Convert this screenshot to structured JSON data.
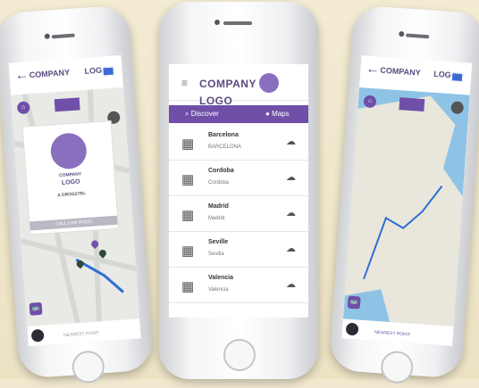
{
  "center_app": {
    "logo_left": "COMPANY",
    "logo_right": "LOGO",
    "menu_icon": "hamburger-icon",
    "tabs": [
      {
        "label": "Discover",
        "icon": "search-icon"
      },
      {
        "label": "Maps",
        "icon": "pin-icon"
      }
    ],
    "maps": [
      {
        "title": "Barcelona",
        "subtitle": "BARCELONA"
      },
      {
        "title": "Cordoba",
        "subtitle": "Cordoba"
      },
      {
        "title": "Madrid",
        "subtitle": "Madrid"
      },
      {
        "title": "Seville",
        "subtitle": "Sevilla"
      },
      {
        "title": "Valencia",
        "subtitle": "Valencia"
      }
    ]
  },
  "left_app": {
    "logo_left": "COMPANY",
    "logo_right": "LOGO",
    "card_logo_top": "COMPANY",
    "card_logo_bottom": "LOGO",
    "card_caption": "A DROSSTEL",
    "card_button": "CALL CAN RODO",
    "nearest_label": "NEAREST POINT"
  },
  "right_app": {
    "logo_left": "COMPANY",
    "logo_right": "LOGO",
    "nearest_label": "NEAREST POINT"
  }
}
